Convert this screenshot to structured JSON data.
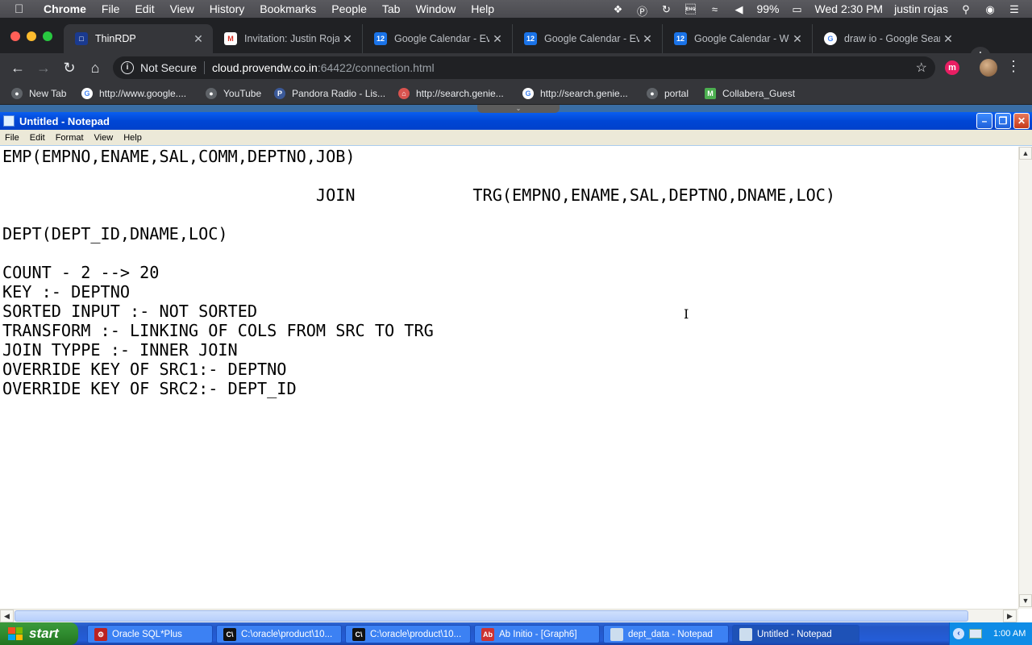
{
  "mac_menubar": {
    "app": "Chrome",
    "items": [
      "File",
      "Edit",
      "View",
      "History",
      "Bookmarks",
      "People",
      "Tab",
      "Window",
      "Help"
    ],
    "battery": "99%",
    "datetime": "Wed 2:30 PM",
    "user": "justin rojas"
  },
  "browser": {
    "tabs": [
      {
        "title": "ThinRDP",
        "icon": "thinrdp-icon",
        "active": true
      },
      {
        "title": "Invitation: Justin Rojas",
        "icon": "gmail-icon",
        "active": false
      },
      {
        "title": "Google Calendar - Eve",
        "icon": "calendar-icon",
        "active": false
      },
      {
        "title": "Google Calendar - Eve",
        "icon": "calendar-icon",
        "active": false
      },
      {
        "title": "Google Calendar - Wee",
        "icon": "calendar-icon",
        "active": false
      },
      {
        "title": "draw io - Google Searc",
        "icon": "google-icon",
        "active": false
      }
    ],
    "calendar_icon_text": "12",
    "url": {
      "security": "Not Secure",
      "host": "cloud.provendw.co.in",
      "path": ":64422/connection.html"
    },
    "bookmarks": [
      "New Tab",
      "http://www.google....",
      "YouTube",
      "Pandora Radio - Lis...",
      "http://search.genie...",
      "http://search.genie...",
      "portal",
      "Collabera_Guest"
    ]
  },
  "notepad": {
    "title": "Untitled - Notepad",
    "menu": [
      "File",
      "Edit",
      "Format",
      "View",
      "Help"
    ],
    "lines": [
      "EMP(EMPNO,ENAME,SAL,COMM,DEPTNO,JOB)",
      "",
      "                                JOIN            TRG(EMPNO,ENAME,SAL,DEPTNO,DNAME,LOC)",
      "",
      "DEPT(DEPT_ID,DNAME,LOC)",
      "",
      "COUNT - 2 --> 20",
      "KEY :- DEPTNO",
      "SORTED INPUT :- NOT SORTED",
      "TRANSFORM :- LINKING OF COLS FROM SRC TO TRG",
      "JOIN TYPPE :- INNER JOIN",
      "OVERRIDE KEY OF SRC1:- DEPTNO",
      "OVERRIDE KEY OF SRC2:- DEPT_ID"
    ]
  },
  "taskbar": {
    "start": "start",
    "items": [
      {
        "label": "Oracle SQL*Plus",
        "icon": "sqlplus-icon",
        "active": false
      },
      {
        "label": "C:\\oracle\\product\\10...",
        "icon": "cmd-icon",
        "active": false
      },
      {
        "label": "C:\\oracle\\product\\10...",
        "icon": "cmd-icon",
        "active": false
      },
      {
        "label": "Ab Initio - [Graph6]",
        "icon": "abinitio-icon",
        "active": false
      },
      {
        "label": "dept_data - Notepad",
        "icon": "notepad-icon",
        "active": false
      },
      {
        "label": "Untitled - Notepad",
        "icon": "notepad-icon",
        "active": true
      }
    ],
    "clock": "1:00 AM"
  }
}
